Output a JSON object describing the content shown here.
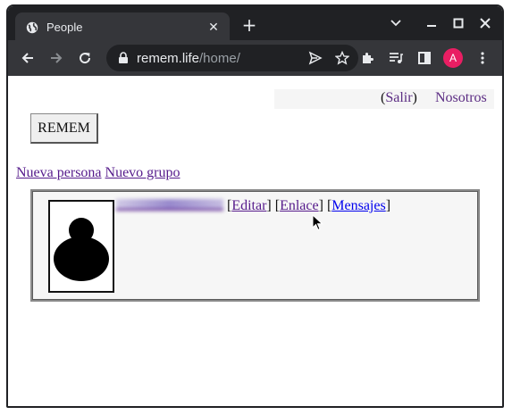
{
  "browser": {
    "tab_title": "People",
    "new_tab_label": "+",
    "url_host": "remem.life",
    "url_path": "/home/",
    "profile_initial": "A"
  },
  "page": {
    "top_nav": {
      "salir_open": "(",
      "salir_label": "Salir",
      "salir_close": ")",
      "nosotros_label": "Nosotros"
    },
    "brand_button": "REMEM",
    "actions": {
      "new_person": "Nueva persona",
      "new_group": "Nuevo grupo"
    },
    "person_card": {
      "edit_label": "Editar",
      "link_label": "Enlace",
      "messages_label": "Mensajes"
    }
  },
  "colors": {
    "tabstrip": "#202124",
    "toolbar": "#35363a",
    "visited_link": "#551a8b",
    "unvisited_link": "#0000ee",
    "avatar": "#e91e63"
  }
}
